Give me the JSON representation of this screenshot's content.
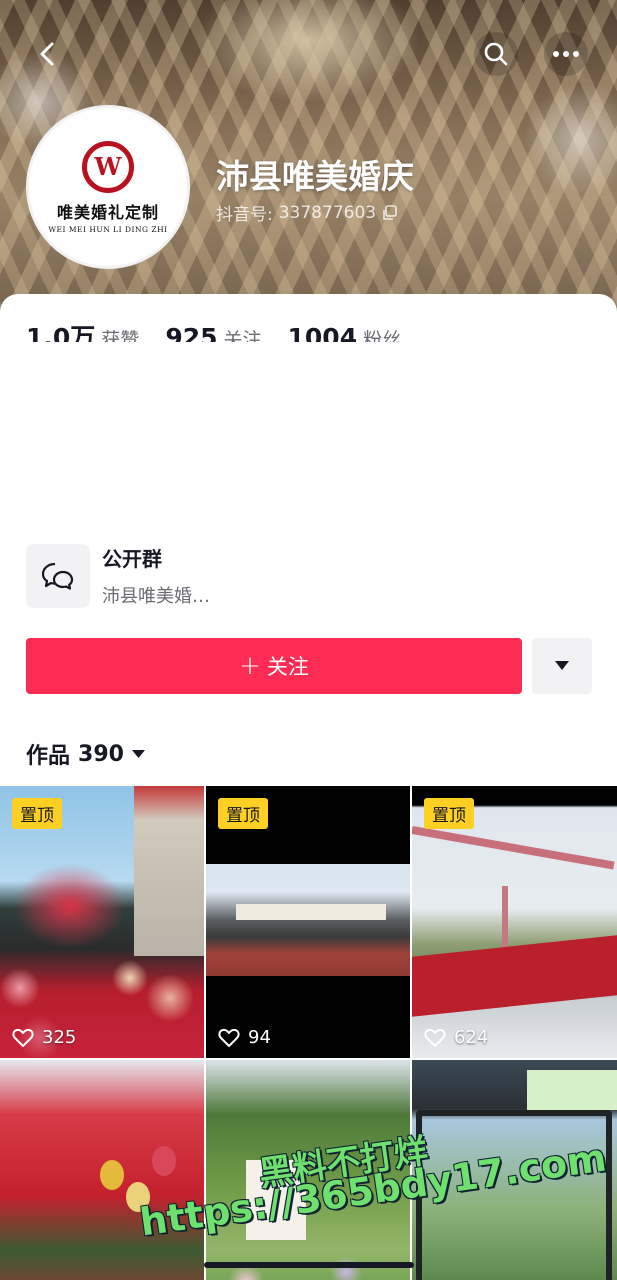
{
  "header": {
    "profile_name": "沛县唯美婚庆",
    "douyin_id_label": "抖音号:",
    "douyin_id": "337877603"
  },
  "avatar": {
    "logo_letters": "W",
    "brand_cn": "唯美婚礼定制",
    "brand_en": "WEI MEI HUN LI DING ZHI"
  },
  "stats": [
    {
      "num": "1.0万",
      "label": "获赞"
    },
    {
      "num": "925",
      "label": "关注"
    },
    {
      "num": "1004",
      "label": "粉丝"
    }
  ],
  "group": {
    "title": "公开群",
    "subtitle": "沛县唯美婚…"
  },
  "actions": {
    "follow_label": "关注",
    "follow_plus": "+"
  },
  "tabs": {
    "works_label": "作品",
    "works_count": "390"
  },
  "videos": [
    {
      "pinned_label": "置顶",
      "likes": "325"
    },
    {
      "pinned_label": "置顶",
      "likes": "94"
    },
    {
      "pinned_label": "置顶",
      "likes": "624"
    },
    {
      "pinned_label": "",
      "likes": ""
    },
    {
      "pinned_label": "",
      "likes": ""
    },
    {
      "pinned_label": "",
      "likes": ""
    }
  ],
  "watermark": {
    "line1": "黑料不打烊",
    "line2": "https://365bdy17.com"
  },
  "colors": {
    "accent": "#fe2c55",
    "pin_badge": "#fdd023",
    "watermark": "#6ee06e"
  },
  "icons": [
    "back-icon",
    "search-icon",
    "more-icon",
    "copy-icon",
    "group-chat-icon",
    "caret-down-icon",
    "heart-icon"
  ]
}
